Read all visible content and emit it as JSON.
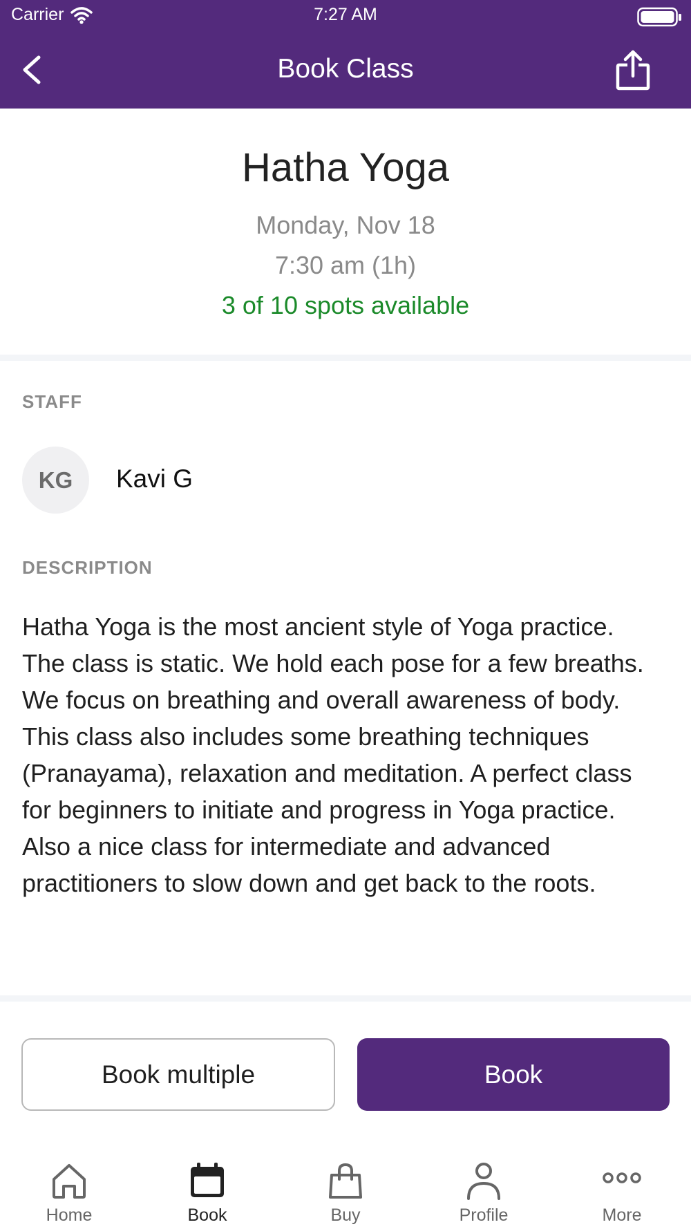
{
  "status_bar": {
    "carrier": "Carrier",
    "time": "7:27 AM"
  },
  "nav": {
    "title": "Book Class"
  },
  "class_info": {
    "title": "Hatha Yoga",
    "date": "Monday, Nov 18",
    "time": "7:30 am (1h)",
    "spots": "3 of 10 spots available"
  },
  "staff": {
    "label": "STAFF",
    "initials": "KG",
    "name": "Kavi G"
  },
  "description": {
    "label": "DESCRIPTION",
    "text": "Hatha Yoga is the most ancient style of Yoga practice. The class is static. We hold each pose for a few breaths. We focus on breathing and overall awareness of body. This class also includes some breathing techniques (Pranayama), relaxation and meditation. A perfect class for beginners to initiate and progress in Yoga practice. Also a nice class for intermediate and advanced practitioners to slow down and get back to the roots."
  },
  "actions": {
    "book_multiple": "Book multiple",
    "book": "Book"
  },
  "tabs": [
    {
      "label": "Home",
      "icon": "home-icon",
      "active": false
    },
    {
      "label": "Book",
      "icon": "calendar-icon",
      "active": true
    },
    {
      "label": "Buy",
      "icon": "shopping-bag-icon",
      "active": false
    },
    {
      "label": "Profile",
      "icon": "person-icon",
      "active": false
    },
    {
      "label": "More",
      "icon": "more-dots-icon",
      "active": false
    }
  ],
  "colors": {
    "brand": "#532a7c",
    "available": "#1b8a2a"
  }
}
